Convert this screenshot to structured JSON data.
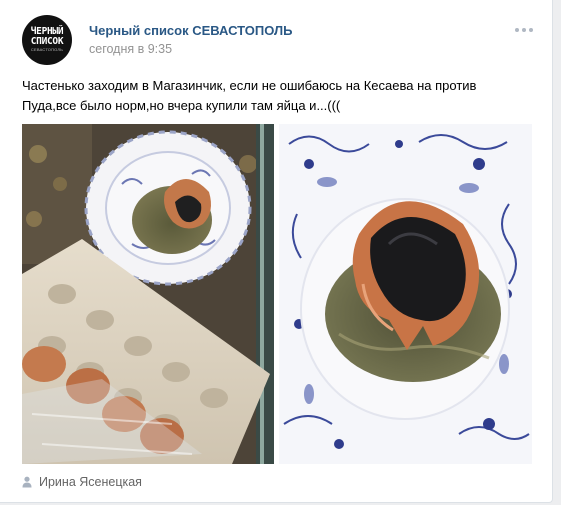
{
  "post": {
    "author": "Черный список СЕВАСТОПОЛЬ",
    "time": "сегодня в 9:35",
    "text": "Частенько заходим в Магазинчик, если не ошибаюсь на Кесаева на против Пуда,все было норм,но вчера купили там яйца и...(((",
    "signer": "Ирина Ясенецкая"
  },
  "avatar": {
    "line1": "ЧЕРНЫЙ",
    "line2": "СПИСОК",
    "line3": "СЕВАСТОПОЛЬ"
  },
  "icons": {
    "more": "more-dots-icon",
    "signer": "user-icon"
  },
  "colors": {
    "author_link": "#2a5885",
    "meta_gray": "#939393",
    "background": "#edeef0"
  }
}
